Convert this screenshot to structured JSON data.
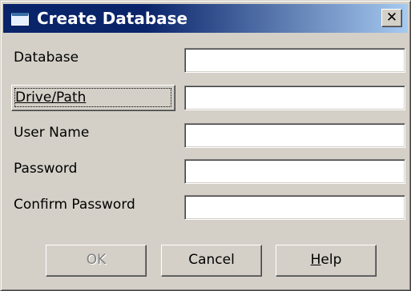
{
  "dialog": {
    "title": "Create Database",
    "close_glyph": "✕",
    "icon": "window-icon"
  },
  "form": {
    "database_label": "Database",
    "database_value": "",
    "drive_path_label": "Drive/Path",
    "drive_path_value": "",
    "user_name_label": "User Name",
    "user_name_value": "",
    "password_label": "Password",
    "password_value": "",
    "confirm_password_label": "Confirm Password",
    "confirm_password_value": ""
  },
  "buttons": {
    "ok_label": "OK",
    "ok_enabled": false,
    "cancel_label": "Cancel",
    "help_mnemonic": "H",
    "help_rest": "elp"
  },
  "colors": {
    "title_bar": "#0a246a",
    "title_bar_gradient_end": "#a6caf0",
    "dialog_face": "#d4d0c8",
    "disabled_text": "#808080"
  }
}
